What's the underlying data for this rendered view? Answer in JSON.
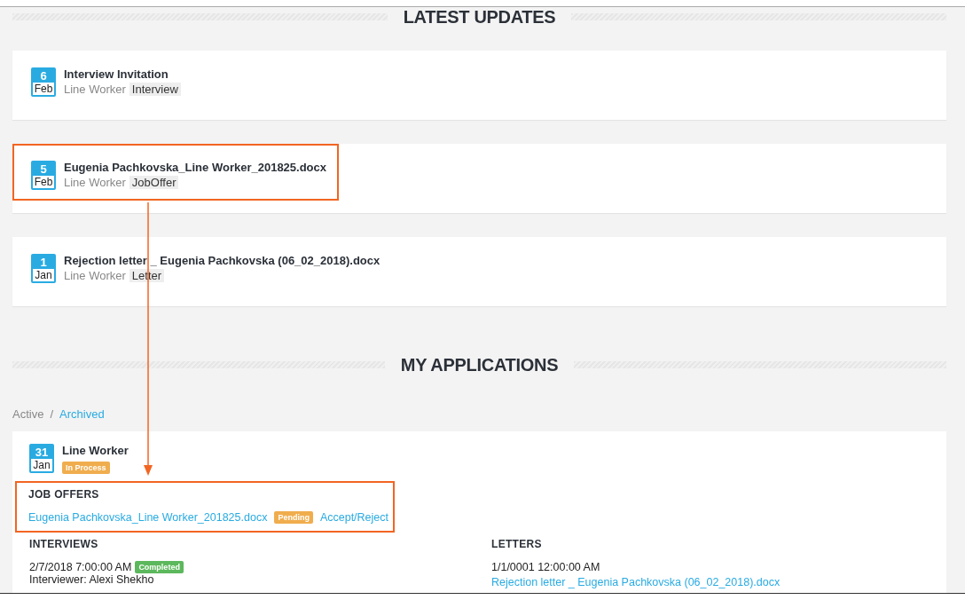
{
  "latest_updates": {
    "title": "LATEST UPDATES",
    "items": [
      {
        "day": "6",
        "month": "Feb",
        "title": "Interview Invitation",
        "position": "Line Worker",
        "tag": "Interview",
        "highlighted": false
      },
      {
        "day": "5",
        "month": "Feb",
        "title": "Eugenia Pachkovska_Line Worker_201825.docx",
        "position": "Line Worker",
        "tag": "JobOffer",
        "highlighted": true
      },
      {
        "day": "1",
        "month": "Jan",
        "title": "Rejection letter _ Eugenia Pachkovska (06_02_2018).docx",
        "position": "Line Worker",
        "tag": "Letter",
        "highlighted": false
      }
    ]
  },
  "my_applications": {
    "title": "MY APPLICATIONS",
    "filters": [
      {
        "label": "Active",
        "selected": true
      },
      {
        "label": "Archived",
        "selected": false
      }
    ],
    "separator": "/",
    "application": {
      "day": "31",
      "month": "Jan",
      "title": "Line Worker",
      "status": "In Process",
      "job_offers": {
        "title": "JOB OFFERS",
        "highlighted": true,
        "items": [
          {
            "file": "Eugenia Pachkovska_Line Worker_201825.docx",
            "status": "Pending",
            "action": "Accept/Reject"
          }
        ]
      },
      "interviews": {
        "title": "INTERVIEWS",
        "items": [
          {
            "datetime": "2/7/2018 7:00:00 AM",
            "status": "Completed",
            "interviewer": "Interviewer: Alexi Shekho"
          }
        ]
      },
      "letters": {
        "title": "LETTERS",
        "items": [
          {
            "datetime": "1/1/0001 12:00:00 AM",
            "file": "Rejection letter _ Eugenia Pachkovska (06_02_2018).docx"
          }
        ]
      }
    }
  }
}
